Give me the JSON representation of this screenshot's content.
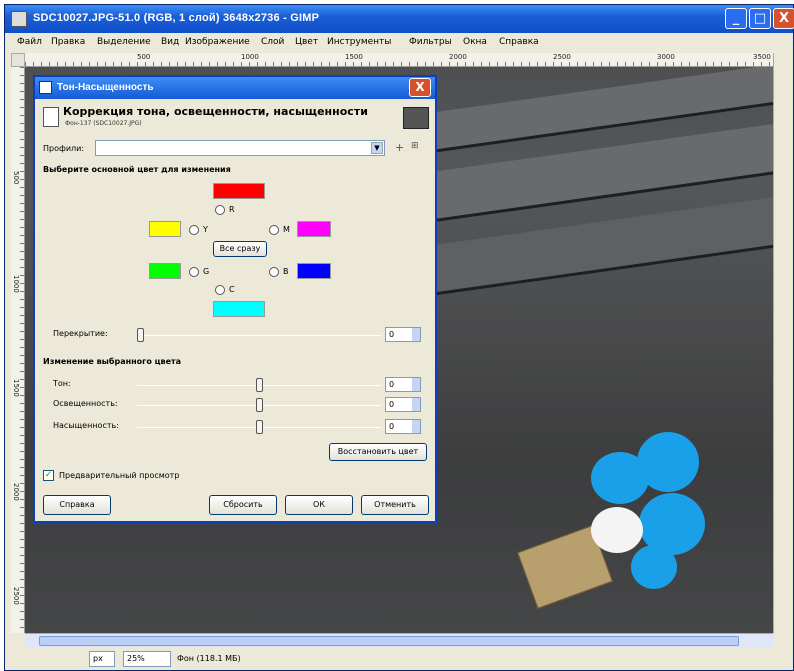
{
  "window": {
    "title": "SDC10027.JPG-51.0 (RGB, 1 слой) 3648x2736 - GIMP",
    "min_label": "_",
    "max_label": "□",
    "close_label": "X"
  },
  "menu": [
    "Файл",
    "Правка",
    "Выделение",
    "Вид",
    "Изображение",
    "Слой",
    "Цвет",
    "Инструменты",
    "Фильтры",
    "Окна",
    "Справка"
  ],
  "ruler": {
    "top": [
      "500",
      "1000",
      "1500",
      "2000",
      "2500",
      "3000",
      "3500"
    ],
    "left": [
      "500",
      "1000",
      "1500",
      "2000",
      "2500"
    ]
  },
  "status": {
    "unit": "px",
    "zoom": "25%",
    "text": "Фон (118.1 МБ)"
  },
  "dialog": {
    "title": "Тон-Насыщенность",
    "close_label": "X",
    "header_title": "Коррекция тона, освещенности, насыщенности",
    "header_sub": "Фон-137 (SDC10027.JPG)",
    "presets_label": "Профили:",
    "presets_value": "",
    "preset_add": "+",
    "preset_menu": "⊞",
    "section_primary": "Выберите основной цвет для изменения",
    "colors": [
      {
        "key": "R",
        "label": "R",
        "hex": "#ff0000"
      },
      {
        "key": "Y",
        "label": "Y",
        "hex": "#ffff00"
      },
      {
        "key": "M",
        "label": "M",
        "hex": "#ff00ff"
      },
      {
        "key": "G",
        "label": "G",
        "hex": "#00ff00"
      },
      {
        "key": "B",
        "label": "B",
        "hex": "#0000ff"
      },
      {
        "key": "C",
        "label": "C",
        "hex": "#00ffff"
      }
    ],
    "all_button": "Все сразу",
    "overlap_label": "Перекрытие:",
    "overlap_value": "0",
    "section_adjust": "Изменение выбранного цвета",
    "hue_label": "Тон:",
    "hue_value": "0",
    "lightness_label": "Освещенность:",
    "lightness_value": "0",
    "saturation_label": "Насыщенность:",
    "saturation_value": "0",
    "reset_color_button": "Восстановить цвет",
    "preview_label": "Предварительный просмотр",
    "help_button": "Справка",
    "reset_button": "Сбросить",
    "ok_button": "ОК",
    "cancel_button": "Отменить"
  },
  "colors": {
    "titlebar": "#0f4fc8",
    "dialog_bg": "#ece9d8",
    "balloon_blue": "#1fa0e8"
  }
}
